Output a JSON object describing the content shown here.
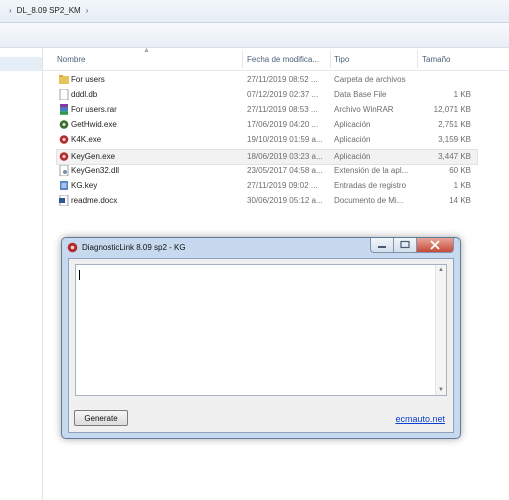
{
  "address": {
    "segments": [
      "DL_8.09 SP2_KM"
    ]
  },
  "columns": {
    "name": "Nombre",
    "date": "Fecha de modifica...",
    "type": "Tipo",
    "size": "Tamaño"
  },
  "files": [
    {
      "name": "For users",
      "date": "27/11/2019 08:52 ...",
      "type": "Carpeta de archivos",
      "size": "",
      "icon": "folder-icon"
    },
    {
      "name": "dddl.db",
      "date": "07/12/2019 02:37 ...",
      "type": "Data Base File",
      "size": "1 KB",
      "icon": "file-icon"
    },
    {
      "name": "For users.rar",
      "date": "27/11/2019 08:53 ...",
      "type": "Archivo WinRAR",
      "size": "12,071 KB",
      "icon": "rar-icon"
    },
    {
      "name": "GetHwid.exe",
      "date": "17/06/2019 04:20 ...",
      "type": "Aplicación",
      "size": "2,751 KB",
      "icon": "exe-icon"
    },
    {
      "name": "K4K.exe",
      "date": "19/10/2019 01:59 a...",
      "type": "Aplicación",
      "size": "3,159 KB",
      "icon": "exe-icon"
    },
    {
      "name": "KeyGen.exe",
      "date": "18/06/2019 03:23 a...",
      "type": "Aplicación",
      "size": "3,447 KB",
      "icon": "exe-icon"
    },
    {
      "name": "KeyGen32.dll",
      "date": "23/05/2017 04:58 a...",
      "type": "Extensión de la apl...",
      "size": "60 KB",
      "icon": "dll-icon"
    },
    {
      "name": "KG.key",
      "date": "27/11/2019 09:02 ...",
      "type": "Entradas de registro",
      "size": "1 KB",
      "icon": "key-icon"
    },
    {
      "name": "readme.docx",
      "date": "30/06/2019 05:12 a...",
      "type": "Documento de Mi...",
      "size": "14 KB",
      "icon": "docx-icon"
    }
  ],
  "dialog": {
    "title": "DiagnosticLink 8.09 sp2 - KG",
    "text_value": "",
    "generate_label": "Generate",
    "link_text": "ecmauto.net"
  },
  "colors": {
    "accent_link": "#0b3fd1",
    "dialog_frame": "#c7d9ee",
    "close_button": "#c44a38"
  }
}
